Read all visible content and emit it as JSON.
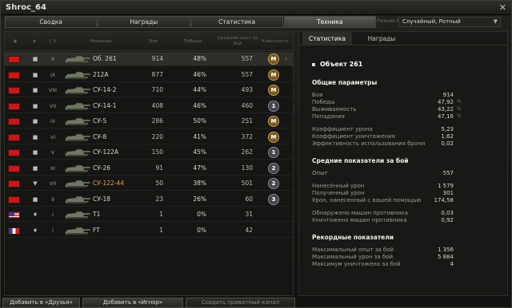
{
  "window": {
    "title": "Shroc_64",
    "close_icon": "close-icon"
  },
  "tabs": [
    "Сводка",
    "Награды",
    "Статистика",
    "Техника"
  ],
  "active_tab": 3,
  "mode": {
    "label": "Режим боя:",
    "value": "Случайный, Ротный"
  },
  "table": {
    "headers": {
      "type": "",
      "tier": "I. X",
      "name": "Название",
      "battles": "Бои",
      "wins": "Победы",
      "exp": "Средний опыт за бой",
      "mastery": "Классность"
    },
    "rows": [
      {
        "flag": "ussr",
        "type": "■",
        "tier": "X",
        "name": "Об. 261",
        "battles": "914",
        "wins": "48%",
        "exp": "557",
        "mastery": "M",
        "selected": true
      },
      {
        "flag": "ussr",
        "type": "■",
        "tier": "IX",
        "name": "212А",
        "battles": "877",
        "wins": "46%",
        "exp": "557",
        "mastery": "M",
        "selected": false
      },
      {
        "flag": "ussr",
        "type": "■",
        "tier": "VIII",
        "name": "СУ-14-2",
        "battles": "710",
        "wins": "44%",
        "exp": "493",
        "mastery": "M",
        "selected": false
      },
      {
        "flag": "ussr",
        "type": "■",
        "tier": "VII",
        "name": "СУ-14-1",
        "battles": "408",
        "wins": "46%",
        "exp": "460",
        "mastery": "1",
        "selected": false
      },
      {
        "flag": "ussr",
        "type": "■",
        "tier": "IV",
        "name": "СУ-5",
        "battles": "286",
        "wins": "50%",
        "exp": "251",
        "mastery": "M",
        "selected": false
      },
      {
        "flag": "ussr",
        "type": "■",
        "tier": "VI",
        "name": "СУ-8",
        "battles": "220",
        "wins": "41%",
        "exp": "372",
        "mastery": "M",
        "selected": false
      },
      {
        "flag": "ussr",
        "type": "■",
        "tier": "V",
        "name": "СУ-122А",
        "battles": "150",
        "wins": "45%",
        "exp": "262",
        "mastery": "1",
        "selected": false
      },
      {
        "flag": "ussr",
        "type": "■",
        "tier": "III",
        "name": "СУ-26",
        "battles": "91",
        "wins": "47%",
        "exp": "130",
        "mastery": "2",
        "selected": false
      },
      {
        "flag": "ussr",
        "type": "▼",
        "tier": "VII",
        "name": "СУ-122-44",
        "battles": "50",
        "wins": "38%",
        "exp": "501",
        "mastery": "2",
        "selected": false,
        "gold": true
      },
      {
        "flag": "ussr",
        "type": "■",
        "tier": "II",
        "name": "СУ-18",
        "battles": "23",
        "wins": "26%",
        "exp": "60",
        "mastery": "3",
        "selected": false
      },
      {
        "flag": "usa",
        "type": "♦",
        "tier": "I",
        "name": "T1",
        "battles": "1",
        "wins": "0%",
        "exp": "31",
        "mastery": "",
        "selected": false
      },
      {
        "flag": "fr",
        "type": "♦",
        "tier": "I",
        "name": "FT",
        "battles": "1",
        "wins": "0%",
        "exp": "42",
        "mastery": "",
        "selected": false
      }
    ]
  },
  "panel": {
    "tabs": [
      "Статистика",
      "Награды"
    ],
    "vehicle": "Объект 261",
    "general": {
      "title": "Общие параметры",
      "items": [
        {
          "label": "Бои",
          "value": "914",
          "pct": ""
        },
        {
          "label": "Победы",
          "value": "47,92",
          "pct": "%"
        },
        {
          "label": "Выживаемость",
          "value": "43,22",
          "pct": "%"
        },
        {
          "label": "Попадания",
          "value": "47,16",
          "pct": "%"
        },
        {
          "label": "Коэффициент урона",
          "value": "5,23",
          "pct": ""
        },
        {
          "label": "Коэффициент уничтожения",
          "value": "1,62",
          "pct": ""
        },
        {
          "label": "Эффективность использования брони",
          "value": "0,02",
          "pct": ""
        }
      ]
    },
    "avg": {
      "title": "Средние показатели за бой",
      "items": [
        {
          "label": "Опыт",
          "value": "557"
        },
        {
          "label": "Нанесённый урон",
          "value": "1 579"
        },
        {
          "label": "Полученный урон",
          "value": "301"
        },
        {
          "label": "Урон, нанесенный с вашей помощью",
          "value": "174,58"
        },
        {
          "label": "Обнаружено машин противника",
          "value": "0,03"
        },
        {
          "label": "Уничтожено машин противника",
          "value": "0,92"
        }
      ]
    },
    "records": {
      "title": "Рекордные показатели",
      "items": [
        {
          "label": "Максимальный опыт за бой",
          "value": "1 356"
        },
        {
          "label": "Максимальный урон за бой",
          "value": "5 884"
        },
        {
          "label": "Максимум уничтожено за бой",
          "value": "4"
        }
      ]
    }
  },
  "buttons": {
    "friends": "Добавить в «Друзья»",
    "ignore": "Добавить в «Игнор»",
    "private": "Создать приватный канал"
  }
}
